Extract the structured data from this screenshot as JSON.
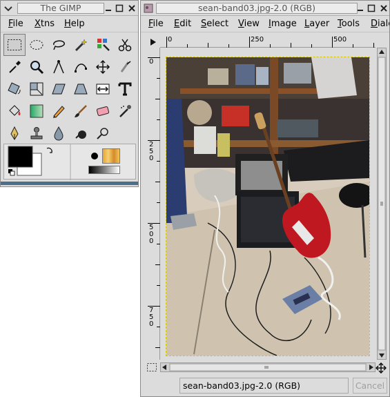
{
  "toolbox": {
    "title": "The GIMP",
    "menu": [
      "File",
      "Xtns",
      "Help"
    ],
    "mnemonics": [
      "F",
      "X",
      "H"
    ],
    "tools": [
      "rect-select",
      "ellipse-select",
      "free-select",
      "fuzzy-select",
      "color-select",
      "scissors",
      "color-picker",
      "zoom",
      "measure",
      "bezier",
      "move",
      "crop",
      "rotate",
      "scale",
      "shear",
      "perspective",
      "flip",
      "text",
      "bucket-fill",
      "blend",
      "pencil",
      "paintbrush",
      "eraser",
      "airbrush",
      "ink",
      "clone",
      "convolve",
      "smudge",
      "dodge-burn"
    ]
  },
  "image_window": {
    "title": "sean-band03.jpg-2.0 (RGB)",
    "menu": [
      "File",
      "Edit",
      "Select",
      "View",
      "Image",
      "Layer",
      "Tools",
      "Dialo"
    ],
    "mnemonics": [
      "F",
      "E",
      "S",
      "V",
      "I",
      "L",
      "T",
      "D"
    ],
    "h_ruler_labels": [
      "0",
      "250",
      "500"
    ],
    "v_ruler_labels": [
      "0",
      "250",
      "500",
      "750"
    ],
    "status": "sean-band03.jpg-2.0 (RGB)",
    "cancel_label": "Cancel"
  }
}
